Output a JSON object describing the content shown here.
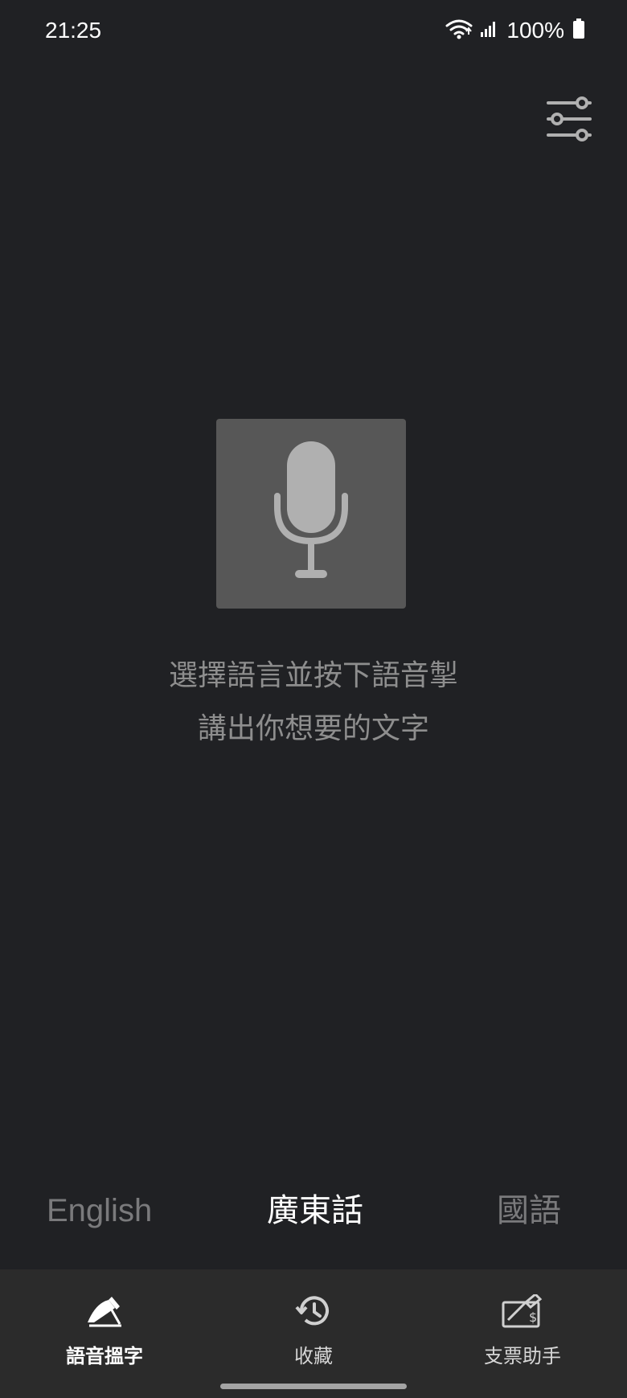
{
  "status_bar": {
    "time": "21:25",
    "battery_text": "100%",
    "icons": [
      "wifi-icon",
      "signal-icon",
      "battery-icon"
    ]
  },
  "toolbar": {
    "settings_icon": "sliders-icon"
  },
  "main": {
    "mic_icon": "microphone-icon",
    "instruction_line1": "選擇語言並按下語音掣",
    "instruction_line2": "講出你想要的文字"
  },
  "languages": [
    {
      "label": "English",
      "active": false
    },
    {
      "label": "廣東話",
      "active": true
    },
    {
      "label": "國語",
      "active": false
    }
  ],
  "bottom_nav": [
    {
      "label": "語音搵字",
      "icon": "pen-write-icon",
      "active": true
    },
    {
      "label": "收藏",
      "icon": "history-icon",
      "active": false
    },
    {
      "label": "支票助手",
      "icon": "cheque-icon",
      "active": false
    }
  ],
  "colors": {
    "background": "#202124",
    "nav_background": "#2b2b2b",
    "mic_tile": "#575757",
    "inactive_text": "#7a7a7c"
  }
}
